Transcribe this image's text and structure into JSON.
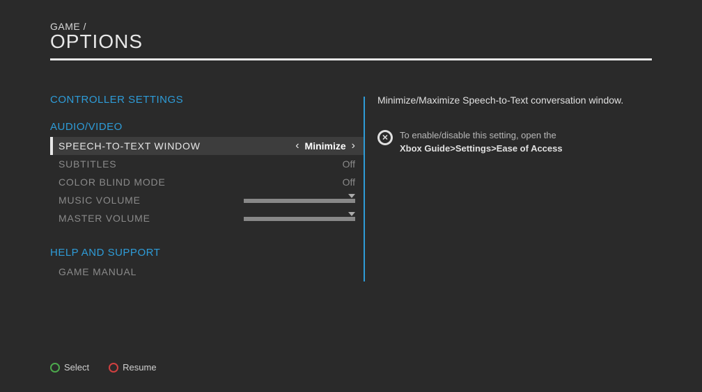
{
  "header": {
    "breadcrumb": "GAME  /",
    "title": "OPTIONS"
  },
  "sections": {
    "controller": "CONTROLLER SETTINGS",
    "av": "AUDIO/VIDEO",
    "help": "HELP AND SUPPORT"
  },
  "menu": {
    "speech": {
      "label": "SPEECH-TO-TEXT WINDOW",
      "value": "Minimize"
    },
    "subtitles": {
      "label": "SUBTITLES",
      "value": "Off"
    },
    "colorblind": {
      "label": "COLOR BLIND MODE",
      "value": "Off"
    },
    "music": {
      "label": "MUSIC VOLUME"
    },
    "master": {
      "label": "MASTER VOLUME"
    },
    "manual": {
      "label": "GAME MANUAL"
    }
  },
  "right": {
    "description": "Minimize/Maximize Speech-to-Text conversation window.",
    "hint_line1": "To enable/disable this setting, open the",
    "hint_line2": "Xbox Guide>Settings>Ease of Access"
  },
  "footer": {
    "select": "Select",
    "resume": "Resume"
  }
}
